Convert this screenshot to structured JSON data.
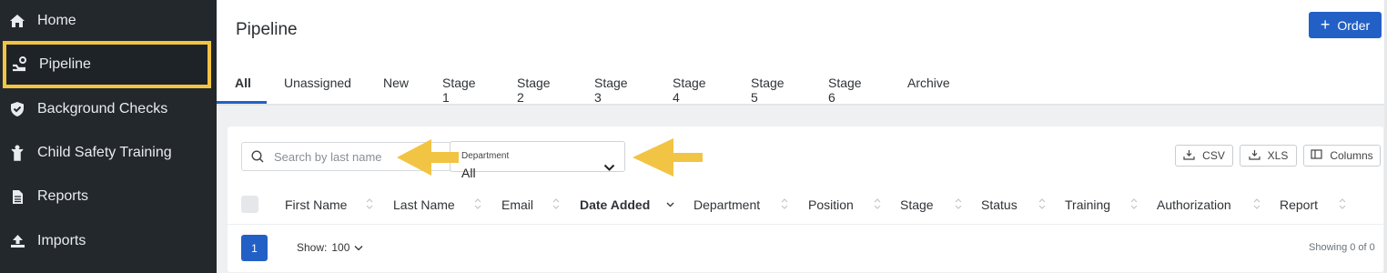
{
  "sidebar": {
    "items": [
      {
        "label": "Home",
        "icon": "home-icon"
      },
      {
        "label": "Pipeline",
        "icon": "pipeline-icon",
        "active": true
      },
      {
        "label": "Background Checks",
        "icon": "shield-check-icon"
      },
      {
        "label": "Child Safety Training",
        "icon": "child-icon"
      },
      {
        "label": "Reports",
        "icon": "document-icon"
      },
      {
        "label": "Imports",
        "icon": "upload-icon"
      }
    ]
  },
  "header": {
    "title": "Pipeline",
    "order_label": "Order"
  },
  "tabs": [
    "All",
    "Unassigned",
    "New",
    "Stage 1",
    "Stage 2",
    "Stage 3",
    "Stage 4",
    "Stage 5",
    "Stage 6",
    "Archive"
  ],
  "filters": {
    "search_placeholder": "Search by last name",
    "department_label": "Department",
    "department_value": "All"
  },
  "toolbar": {
    "csv_label": "CSV",
    "xls_label": "XLS",
    "columns_label": "Columns"
  },
  "table": {
    "columns": [
      "First Name",
      "Last Name",
      "Email",
      "Date Added",
      "Department",
      "Position",
      "Stage",
      "Status",
      "Training",
      "Authorization",
      "Report"
    ],
    "sorted_column": "Date Added"
  },
  "footer": {
    "page": "1",
    "show_label": "Show:",
    "show_value": "100",
    "showing_text": "Showing 0 of 0"
  },
  "colors": {
    "accent": "#2360c6",
    "sidebar_bg": "#23282c",
    "highlight": "#f2c443"
  }
}
